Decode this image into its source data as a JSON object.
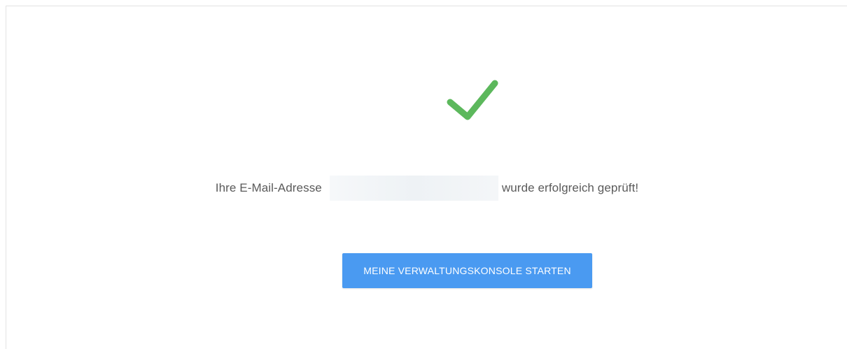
{
  "verification": {
    "icon": "checkmark-icon",
    "icon_color": "#5cb85c",
    "message_before": "Ihre E-Mail-Adresse",
    "email": "",
    "message_after": "wurde erfolgreich geprüft!"
  },
  "actions": {
    "launch_console_label": "MEINE VERWALTUNGSKONSOLE STARTEN",
    "button_color": "#4a9af1"
  }
}
